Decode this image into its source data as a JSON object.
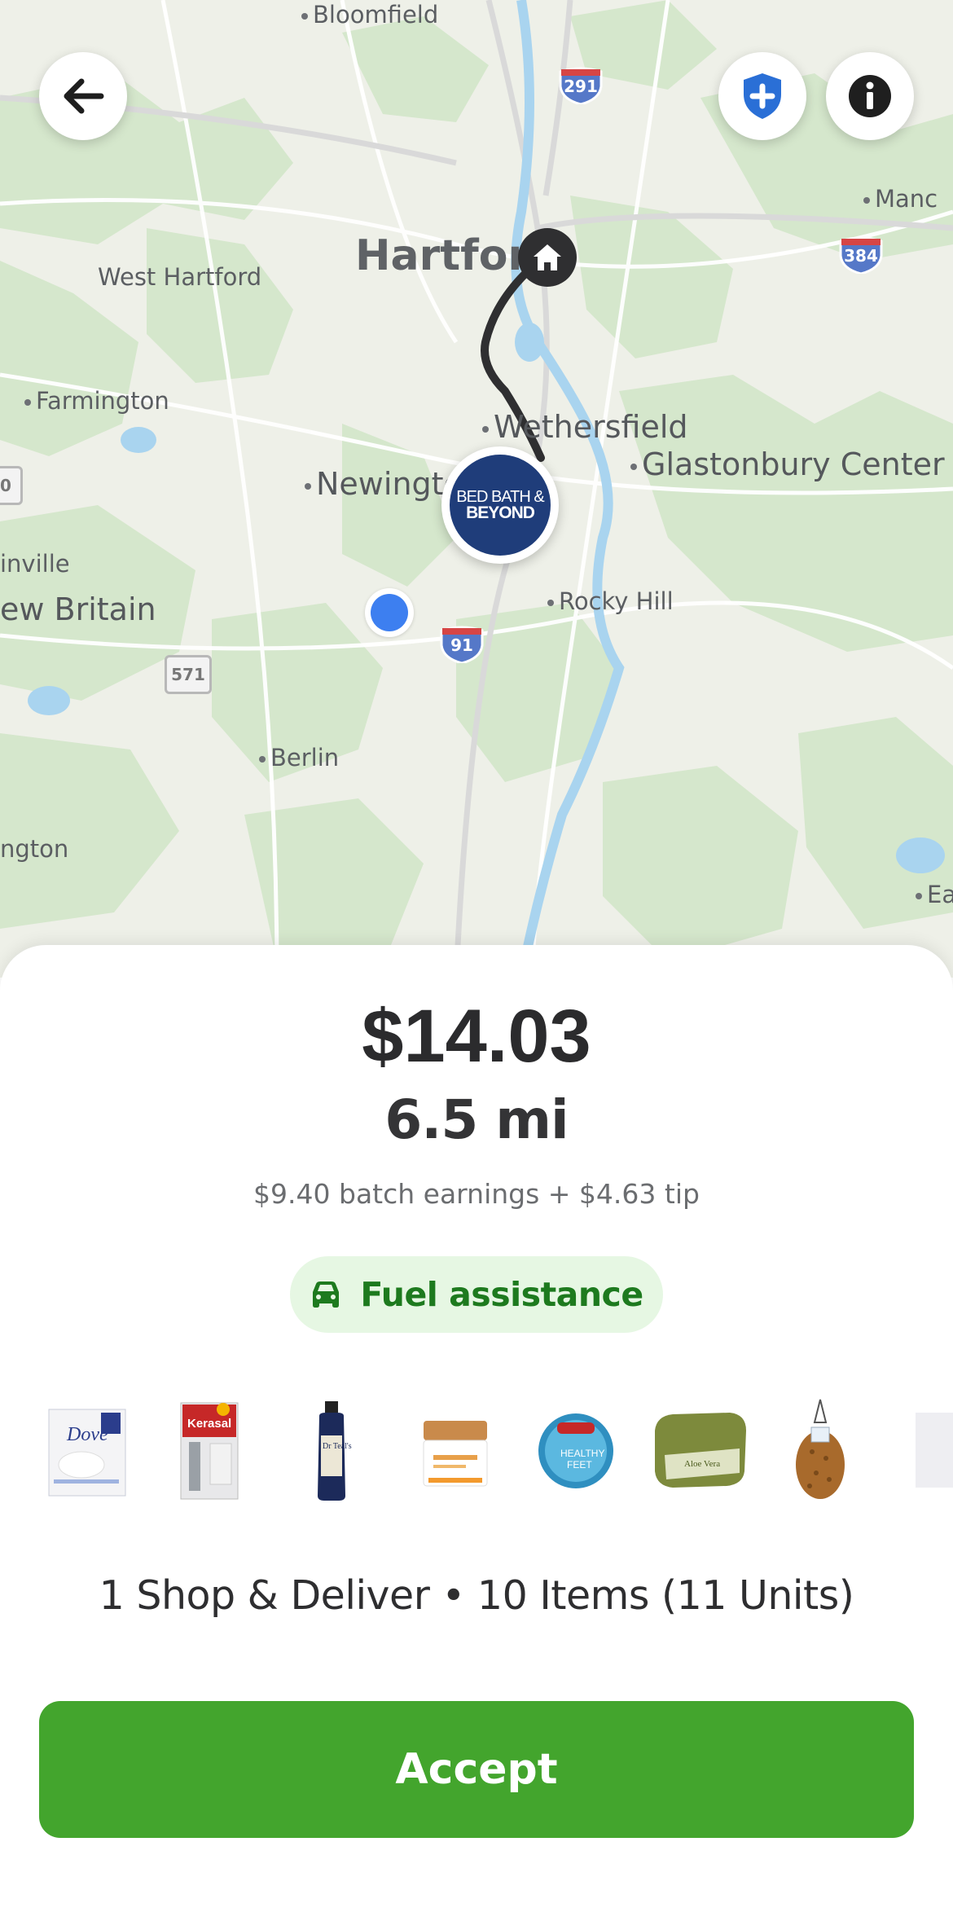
{
  "map": {
    "places": [
      {
        "name": "Bloomfield"
      },
      {
        "name": "Hartford"
      },
      {
        "name": "West Hartford"
      },
      {
        "name": "Farmington"
      },
      {
        "name": "Wethersfield"
      },
      {
        "name": "Newington"
      },
      {
        "name": "Glastonbury Center"
      },
      {
        "name": "inville"
      },
      {
        "name": "ew Britain"
      },
      {
        "name": "Rocky Hill"
      },
      {
        "name": "Berlin"
      },
      {
        "name": "ngton"
      },
      {
        "name": "Manc"
      },
      {
        "name": "Ea"
      }
    ],
    "highways": [
      "291",
      "384",
      "91"
    ],
    "routes": [
      "571",
      "0"
    ],
    "store_logo_line1": "BED BATH &",
    "store_logo_line2": "BEYOND"
  },
  "controls": {
    "back_icon": "arrow-left-icon",
    "safety_icon": "shield-plus-icon",
    "info_icon": "info-icon"
  },
  "offer": {
    "price": "$14.03",
    "distance": "6.5 mi",
    "earnings_detail": "$9.40 batch earnings + $4.63 tip",
    "badge": "Fuel assistance",
    "products": [
      "Dove soap",
      "Kerasal",
      "Dr Teal's",
      "Skin cream jar",
      "O'Keeffe's Healthy Feet",
      "Aloe Vera soap",
      "Loofah sponge",
      "Item"
    ],
    "summary": "1 Shop & Deliver • 10 Items (11 Units)",
    "accept_label": "Accept"
  },
  "colors": {
    "accent": "#43a52d",
    "badge_bg": "#e6f7e3",
    "badge_text": "#1d7a1e",
    "location_dot": "#3d7ff0",
    "store_blue": "#1f3d7a"
  }
}
